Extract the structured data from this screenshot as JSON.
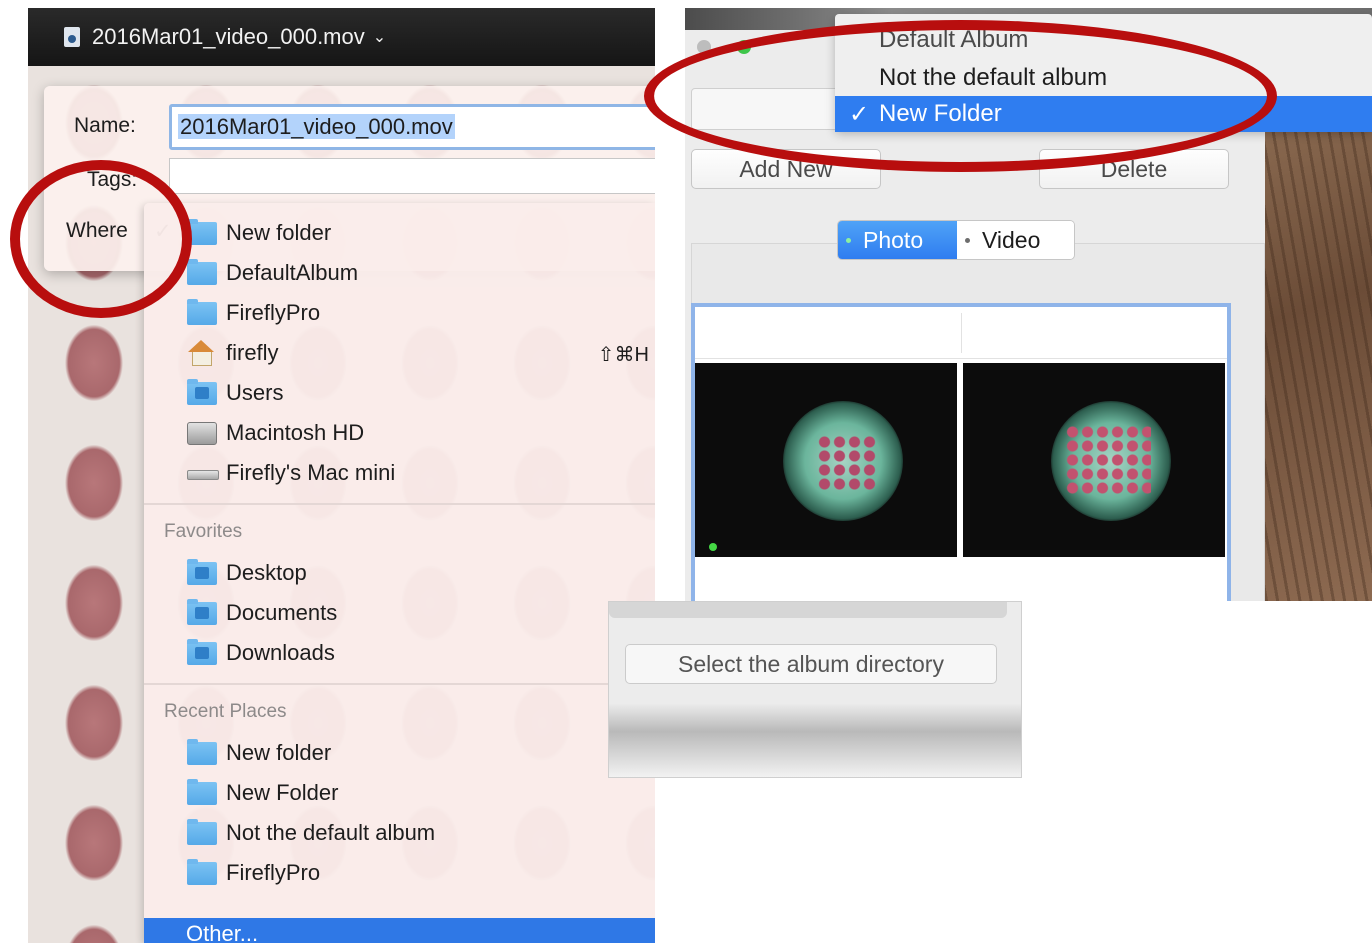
{
  "save_dialog": {
    "title": "2016Mar01_video_000.mov",
    "name_label": "Name:",
    "name_value": "2016Mar01_video_000.mov",
    "tags_label": "Tags:",
    "where_label": "Where",
    "where_check": "✓"
  },
  "where_menu": {
    "locations": [
      {
        "label": "New folder",
        "icon": "folder-icon"
      },
      {
        "label": "DefaultAlbum",
        "icon": "folder-icon"
      },
      {
        "label": "FireflyPro",
        "icon": "folder-icon"
      },
      {
        "label": "firefly",
        "icon": "home-icon",
        "shortcut": "⇧⌘H"
      },
      {
        "label": "Users",
        "icon": "users-folder-icon"
      },
      {
        "label": "Macintosh HD",
        "icon": "hard-drive-icon"
      },
      {
        "label": "Firefly's Mac mini",
        "icon": "mac-mini-icon"
      }
    ],
    "favorites_header": "Favorites",
    "favorites": [
      {
        "label": "Desktop",
        "icon": "desktop-folder-icon"
      },
      {
        "label": "Documents",
        "icon": "documents-folder-icon"
      },
      {
        "label": "Downloads",
        "icon": "downloads-folder-icon"
      }
    ],
    "recent_header": "Recent Places",
    "recent": [
      {
        "label": "New folder",
        "icon": "folder-icon"
      },
      {
        "label": "New Folder",
        "icon": "folder-icon"
      },
      {
        "label": "Not the default album",
        "icon": "folder-icon"
      },
      {
        "label": "FireflyPro",
        "icon": "folder-icon"
      }
    ],
    "other": "Other..."
  },
  "album_popup": {
    "items": [
      "Default Album",
      "Not the default album",
      "New Folder"
    ],
    "selected_check": "✓"
  },
  "app_window": {
    "add_button": "Add New",
    "delete_button": "Delete",
    "segments": [
      "Photo",
      "Video"
    ]
  },
  "small_window": {
    "select_button": "Select the album directory"
  },
  "colors": {
    "annotation_red": "#b80e0e",
    "selection_blue": "#2f7df0"
  }
}
